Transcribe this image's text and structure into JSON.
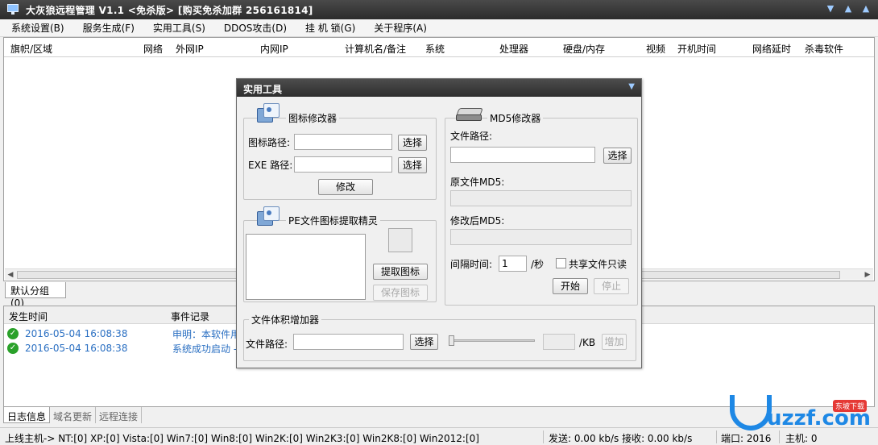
{
  "window": {
    "title": "大灰狼远程管理  V1.1 <免杀版> [购买免杀加群 256161814]",
    "controls": [
      "▼",
      "▲",
      "▲"
    ]
  },
  "menu": [
    "系统设置(B)",
    "服务生成(F)",
    "实用工具(S)",
    "DDOS攻击(D)",
    "挂 机 锁(G)",
    "关于程序(A)"
  ],
  "list": {
    "columns": [
      "旗帜/区域",
      "网络",
      "外网IP",
      "内网IP",
      "计算机名/备注",
      "系统",
      "处理器",
      "硬盘/内存",
      "视频",
      "开机时间",
      "网络延时",
      "杀毒软件"
    ]
  },
  "group_tab": "默认分组(0)",
  "log": {
    "columns": [
      "发生时间",
      "事件记录"
    ],
    "rows": [
      {
        "time": "2016-05-04 16:08:38",
        "event": "申明：本软件用"
      },
      {
        "time": "2016-05-04 16:08:38",
        "event": "系统成功启动 -"
      }
    ]
  },
  "bottom_tabs": [
    "日志信息",
    "域名更新",
    "远程连接"
  ],
  "status": {
    "online": "上线主机-> NT:[0] XP:[0] Vista:[0] Win7:[0] Win8:[0] Win2K:[0] Win2K3:[0] Win2K8:[0] Win2012:[0]",
    "traffic": "发送: 0.00 kb/s 接收: 0.00 kb/s",
    "port": "端口: 2016",
    "hosts": "主机: 0"
  },
  "dialog": {
    "title": "实用工具",
    "icon_modifier": {
      "legend": "图标修改器",
      "icon_path_label": "图标路径:",
      "icon_path_value": "",
      "exe_path_label": "EXE 路径:",
      "exe_path_value": "",
      "select_label": "选择",
      "modify_label": "修改"
    },
    "pe_extractor": {
      "legend": "PE文件图标提取精灵",
      "extract_label": "提取图标",
      "save_label": "保存图标"
    },
    "md5_modifier": {
      "legend": "MD5修改器",
      "file_path_label": "文件路径:",
      "select_label": "选择",
      "orig_md5_label": "原文件MD5:",
      "new_md5_label": "修改后MD5:",
      "interval_label": "间隔时间:",
      "interval_value": "1",
      "interval_unit": "/秒",
      "share_readonly_label": "共享文件只读",
      "start_label": "开始",
      "stop_label": "停止"
    },
    "size_increaser": {
      "legend": "文件体积增加器",
      "file_path_label": "文件路径:",
      "select_label": "选择",
      "kb_unit": "/KB",
      "increase_label": "增加"
    }
  },
  "watermark": {
    "text": "uzzf.com",
    "badge": "东坡下载"
  }
}
